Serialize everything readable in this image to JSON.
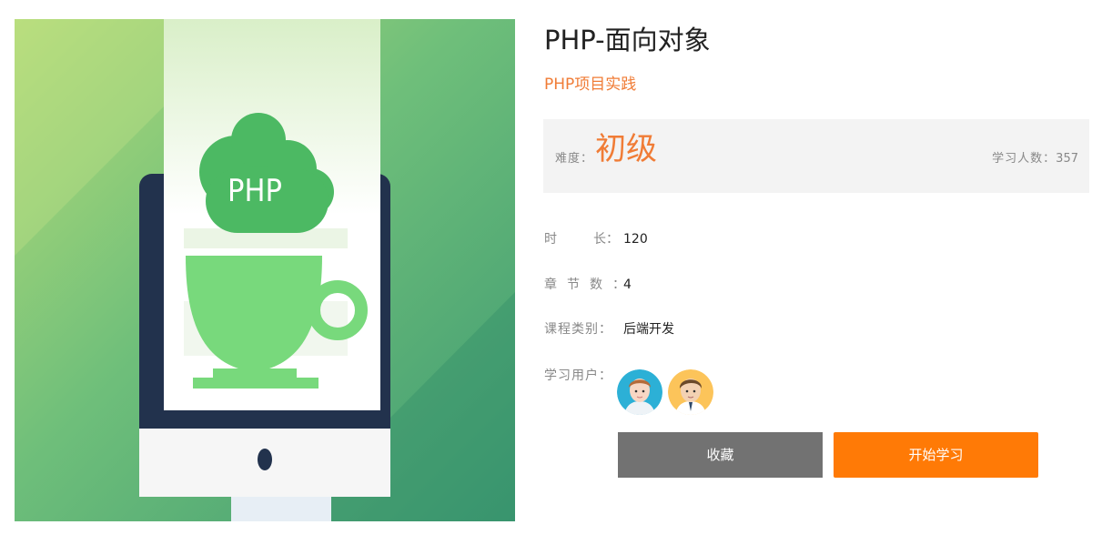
{
  "course": {
    "title": "PHP-面向对象",
    "subtitle": "PHP项目实践",
    "cover_icon": "php-coffee-cup-monitor-illustration",
    "cover_label": "PHP"
  },
  "stats": {
    "level_label": "难度：",
    "level_value": "初级",
    "learners_label": "学习人数：",
    "learners_count": "357"
  },
  "details": {
    "duration_label": "时长：",
    "duration_value": "120",
    "chapters_label": "章节数：",
    "chapters_value": "4",
    "category_label": "课程类别：",
    "category_value": "后端开发",
    "users_label": "学习用户："
  },
  "users": [
    {
      "icon": "male-user-avatar-blue"
    },
    {
      "icon": "male-user-avatar-yellow"
    }
  ],
  "actions": {
    "favorite_label": "收藏",
    "start_label": "开始学习"
  },
  "colors": {
    "accent_orange": "#f07c36",
    "start_button": "#ff7a06",
    "favorite_button": "#727272",
    "stat_box_bg": "#f3f3f3"
  }
}
